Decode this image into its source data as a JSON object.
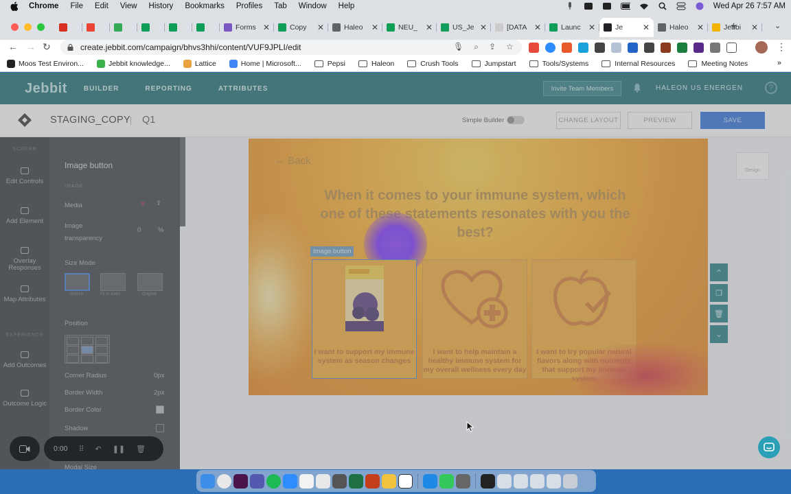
{
  "menubar": {
    "app": "Chrome",
    "items": [
      "File",
      "Edit",
      "View",
      "History",
      "Bookmarks",
      "Profiles",
      "Tab",
      "Window",
      "Help"
    ],
    "clock": "Wed Apr 26  7:57 AM"
  },
  "tabs": [
    {
      "label": "",
      "color": "#d93025"
    },
    {
      "label": "",
      "color": "#ea4335"
    },
    {
      "label": "",
      "color": "#34a853"
    },
    {
      "label": "",
      "color": "#0f9d58"
    },
    {
      "label": "",
      "color": "#0f9d58"
    },
    {
      "label": "",
      "color": "#0f9d58"
    },
    {
      "label": "Forms",
      "color": "#7b57c4"
    },
    {
      "label": "Copy",
      "color": "#0f9d58"
    },
    {
      "label": "Haleo",
      "color": "#5f6368"
    },
    {
      "label": "NEU_",
      "color": "#0f9d58"
    },
    {
      "label": "US_Je",
      "color": "#0f9d58"
    },
    {
      "label": "[DATA",
      "color": "#cccccc"
    },
    {
      "label": "Launc",
      "color": "#0f9d58"
    },
    {
      "label": "Je",
      "color": "#202124",
      "active": true
    },
    {
      "label": "Haleo",
      "color": "#5f6368"
    },
    {
      "label": "Jebbi",
      "color": "#f4b400"
    }
  ],
  "address": {
    "url": "create.jebbit.com/campaign/bhvs3hhi/content/VUF9JPLI/edit"
  },
  "bookmarks": [
    {
      "label": "Moos Test Environ...",
      "kind": "site",
      "color": "#222222"
    },
    {
      "label": "Jebbit knowledge...",
      "kind": "site",
      "color": "#3ab14a"
    },
    {
      "label": "Lattice",
      "kind": "site",
      "color": "#e8a33d"
    },
    {
      "label": "Home | Microsoft...",
      "kind": "site",
      "color": "#4285f4"
    },
    {
      "label": "Pepsi",
      "kind": "folder"
    },
    {
      "label": "Haleon",
      "kind": "folder"
    },
    {
      "label": "Crush Tools",
      "kind": "folder"
    },
    {
      "label": "Jumpstart",
      "kind": "folder"
    },
    {
      "label": "Tools/Systems",
      "kind": "folder"
    },
    {
      "label": "Internal Resources",
      "kind": "folder"
    },
    {
      "label": "Meeting Notes",
      "kind": "folder"
    }
  ],
  "app": {
    "logo": "Jebbit",
    "nav": [
      "BUILDER",
      "REPORTING",
      "ATTRIBUTES"
    ],
    "invite": "Invite Team Members",
    "account": "HALEON US ENERGEN",
    "project_title": "STAGING_COPY",
    "page": "Q1",
    "simple_builder": "Simple Builder",
    "change_layout": "CHANGE LAYOUT",
    "preview": "PREVIEW",
    "save": "SAVE"
  },
  "rail": {
    "section1": "SCREEN",
    "section2": "EXPERIENCE",
    "items": [
      {
        "label": "Edit Controls"
      },
      {
        "label": "Add Element"
      },
      {
        "label": "Overlay Responses"
      },
      {
        "label": "Map Attributes"
      },
      {
        "label": "Add Outcomes"
      },
      {
        "label": "Outcome Logic"
      }
    ]
  },
  "panel": {
    "title": "Image button",
    "section_image": "IMAGE",
    "media": "Media",
    "transparency_label": "Image transparency",
    "transparency_value": "0",
    "transparency_unit": "%",
    "size_mode": "Size Mode",
    "size_options": [
      "Stretch",
      "Fit to width",
      "Original"
    ],
    "position": "Position",
    "corner_radius": "Corner Radius",
    "corner_radius_value": "0px",
    "border_width": "Border Width",
    "border_width_value": "2px",
    "border_color": "Border Color",
    "shadow": "Shadow",
    "modal_size": "Modal Size"
  },
  "quiz": {
    "back": "Back",
    "question": "When it comes to your immune system, which one of these statements resonates with you the best?",
    "selected_tag": "Image button",
    "answers": [
      {
        "text": "I want to support my immune system as season changes"
      },
      {
        "text": "I want to help maintain a healthy immune system for my overall wellness every day"
      },
      {
        "text": "I want to try popular natural flavors along with nutrients that support my immune system"
      }
    ],
    "design_label": "Design"
  },
  "recorder": {
    "time": "0:00"
  }
}
